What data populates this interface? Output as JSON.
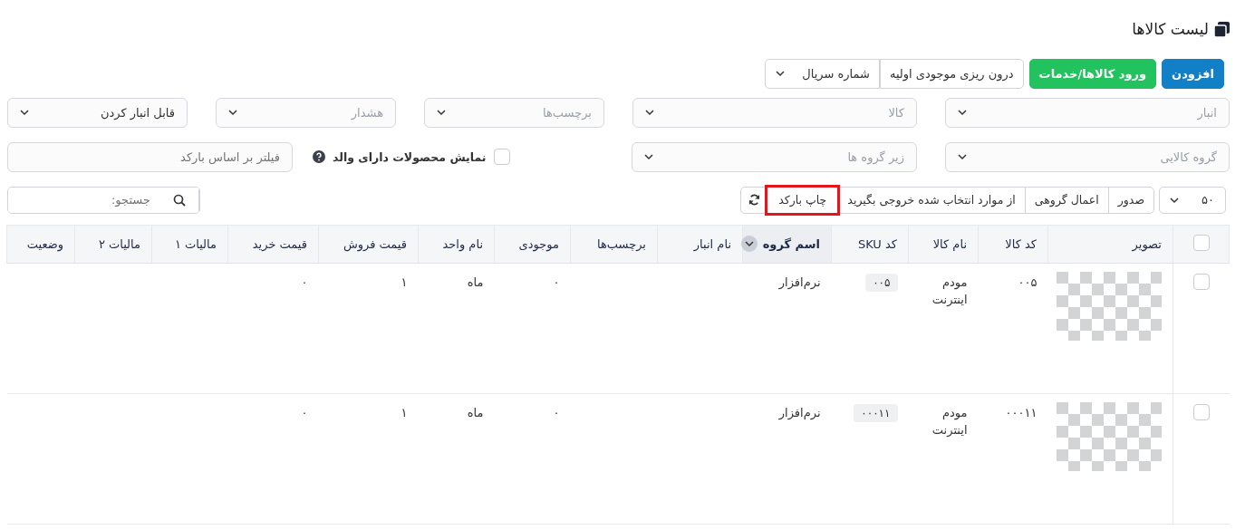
{
  "title": "لیست کالاها",
  "actions": [
    {
      "label": "افزودن",
      "kind": "primary"
    },
    {
      "label": "ورود کالاها/خدمات",
      "kind": "success"
    },
    {
      "label": "درون ریزی موجودی اولیه",
      "kind": "default"
    },
    {
      "label": "شماره سریال",
      "kind": "dropdown"
    }
  ],
  "filter_rows": [
    [
      {
        "kind": "select",
        "placeholder": "انبار"
      },
      {
        "kind": "select",
        "placeholder": "کالا"
      },
      {
        "kind": "select",
        "placeholder": "برچسب‌ها"
      },
      {
        "kind": "select",
        "placeholder": "هشدار"
      },
      {
        "kind": "select",
        "value": "قابل انبار کردن"
      }
    ],
    [
      {
        "kind": "select",
        "placeholder": "گروه کالایی"
      },
      {
        "kind": "select",
        "placeholder": "زیر گروه ها"
      },
      {
        "kind": "checkbox",
        "label": "نمایش محصولات دارای والد",
        "checked": false
      },
      {
        "kind": "input",
        "placeholder": "فیلتر بر اساس بارکد"
      }
    ]
  ],
  "page_size": "۵۰",
  "toolbar_buttons": [
    {
      "label": "صدور",
      "highlighted": false
    },
    {
      "label": "اعمال گروهی",
      "highlighted": false
    },
    {
      "label": "از موارد انتخاب شده خروجی بگیرید",
      "highlighted": false
    },
    {
      "label": "چاپ بارکد",
      "highlighted": true
    }
  ],
  "search": {
    "placeholder": "جستجو:"
  },
  "table": {
    "select_all": {
      "checked": false
    },
    "columns": [
      {
        "label": "تصویر",
        "sorted": false
      },
      {
        "label": "کد کالا",
        "sorted": false
      },
      {
        "label": "نام کالا",
        "sorted": false
      },
      {
        "label": "کد SKU",
        "sorted": false
      },
      {
        "label": "اسم گروه",
        "sorted": true
      },
      {
        "label": "نام انبار",
        "sorted": false
      },
      {
        "label": "برچسب‌ها",
        "sorted": false
      },
      {
        "label": "موجودی",
        "sorted": false
      },
      {
        "label": "نام واحد",
        "sorted": false
      },
      {
        "label": "قیمت فروش",
        "sorted": false
      },
      {
        "label": "قیمت خرید",
        "sorted": false
      },
      {
        "label": "مالیات ۱",
        "sorted": false
      },
      {
        "label": "مالیات ۲",
        "sorted": false
      },
      {
        "label": "وضعیت",
        "sorted": false
      }
    ],
    "rows": [
      {
        "checked": false,
        "code": "۰۰۵",
        "name": "مودم اینترنت",
        "sku": "۰۰۵",
        "group": "نرم‌افزار",
        "stock": "۰",
        "unit": "ماه",
        "sale_price": "۱",
        "buy_price": "۰"
      },
      {
        "checked": false,
        "code": "۰۰۰۱۱",
        "name": "مودم اینترنت",
        "sku": "۰۰۰۱۱",
        "group": "نرم‌افزار",
        "stock": "۰",
        "unit": "ماه",
        "sale_price": "۱",
        "buy_price": "۰"
      }
    ]
  }
}
